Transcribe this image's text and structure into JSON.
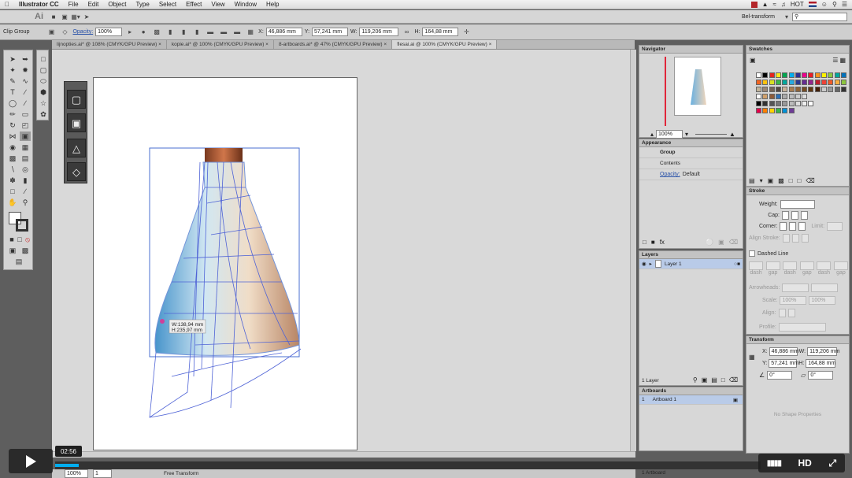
{
  "menubar": {
    "app": "Illustrator CC",
    "items": [
      "File",
      "Edit",
      "Object",
      "Type",
      "Select",
      "Effect",
      "View",
      "Window",
      "Help"
    ],
    "right_items": [
      "HOT"
    ]
  },
  "appbar": {
    "logo": "Ai",
    "workspace": "Bel-transform"
  },
  "control": {
    "selection": "Clip Group",
    "opacity_label": "Opacity:",
    "opacity_value": "100%",
    "x_label": "X:",
    "x": "46,886 mm",
    "y_label": "Y:",
    "y": "57,241 mm",
    "w_label": "W:",
    "w": "119,206 mm",
    "h_label": "H:",
    "h": "164,88 mm"
  },
  "tabs": [
    "lijnopties.ai* @ 108% (CMYK/GPU Preview)",
    "kopie.ai* @ 100% (CMYK/GPU Preview)",
    "8-artboards.ai* @ 47% (CMYK/GPU Preview)",
    "flesai.ai @ 100% (CMYK/GPU Preview)"
  ],
  "canvas": {
    "tooltip_w": "W:138,94 mm",
    "tooltip_h": "H:235,97 mm"
  },
  "navigator": {
    "title": "Navigator",
    "zoom": "100%"
  },
  "appearance": {
    "title": "Appearance",
    "group": "Group",
    "contents": "Contents",
    "opacity_label": "Opacity:",
    "opacity_value": "Default"
  },
  "layers": {
    "title": "Layers",
    "layer1": "Layer 1",
    "footer": "1 Layer"
  },
  "artboards": {
    "title": "Artboards",
    "num": "1",
    "name": "Artboard 1"
  },
  "swatches": {
    "title": "Swatches"
  },
  "stroke": {
    "title": "Stroke",
    "weight": "Weight:",
    "cap": "Cap:",
    "corner": "Corner:",
    "limit": "Limit:",
    "align": "Align Stroke:",
    "dashed": "Dashed Line",
    "dash_labels": [
      "dash",
      "gap",
      "dash",
      "gap",
      "dash",
      "gap"
    ],
    "arrowheads": "Arrowheads:",
    "scale": "Scale:",
    "scale_v1": "100%",
    "scale_v2": "100%",
    "align2": "Align:",
    "profile": "Profile:"
  },
  "transform": {
    "title": "Transform",
    "x": "46,886 mm",
    "y": "57,241 mm",
    "w": "119,206 mm",
    "h": "164,88 mm",
    "angle": "0°",
    "shear": "0°",
    "no_shape": "No Shape Properties"
  },
  "status": {
    "zoom": "100%",
    "page": "1",
    "mode": "Free Transform",
    "artboard": "1 Artboard"
  },
  "video": {
    "time": "02:56",
    "hd": "HD"
  }
}
